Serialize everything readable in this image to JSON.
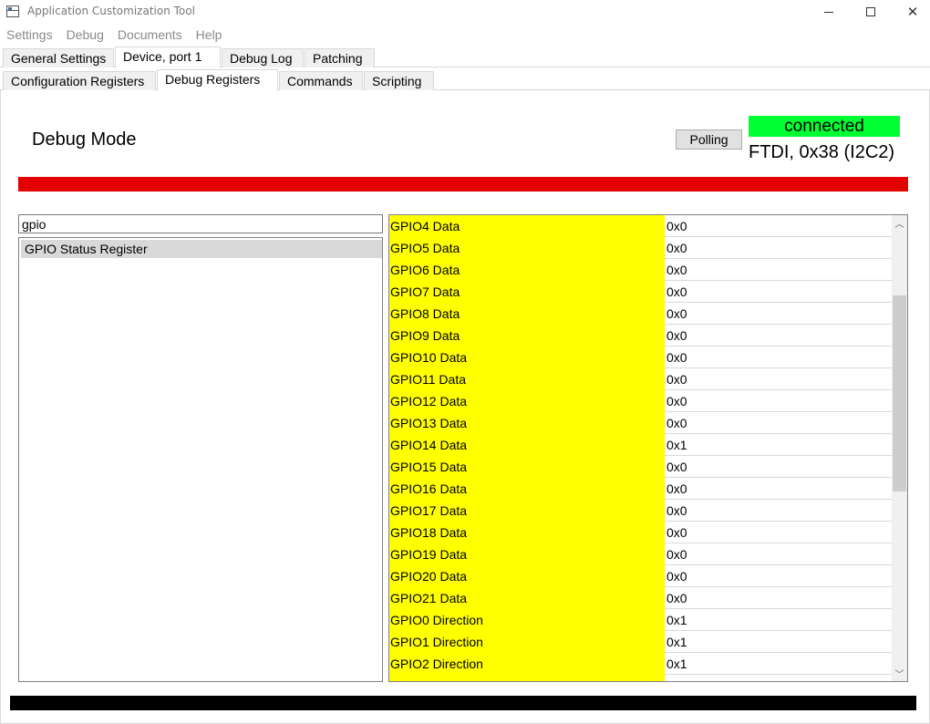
{
  "window": {
    "title": "Application Customization Tool"
  },
  "menu": {
    "items": [
      "Settings",
      "Debug",
      "Documents",
      "Help"
    ]
  },
  "tabs": {
    "top": [
      "General Settings",
      "Device, port 1",
      "Debug Log",
      "Patching"
    ],
    "top_active": "Device, port 1",
    "sub": [
      "Configuration Registers",
      "Debug Registers",
      "Commands",
      "Scripting"
    ],
    "sub_active": "Debug Registers"
  },
  "header": {
    "mode_title": "Debug Mode",
    "polling_label": "Polling",
    "status_text": "connected",
    "connection_info": "FTDI, 0x38 (I2C2)"
  },
  "colors": {
    "status_ok": "#00ff33",
    "alert_bar": "#e30000",
    "highlight": "#ffff00",
    "footer_bar": "#000000"
  },
  "search": {
    "value": "gpio"
  },
  "register_list": {
    "items": [
      "GPIO Status Register"
    ],
    "selected": "GPIO Status Register"
  },
  "grid": {
    "rows": [
      {
        "name": "GPIO4 Data",
        "value": "0x0"
      },
      {
        "name": "GPIO5 Data",
        "value": "0x0"
      },
      {
        "name": "GPIO6 Data",
        "value": "0x0"
      },
      {
        "name": "GPIO7 Data",
        "value": "0x0"
      },
      {
        "name": "GPIO8 Data",
        "value": "0x0"
      },
      {
        "name": "GPIO9 Data",
        "value": "0x0"
      },
      {
        "name": "GPIO10 Data",
        "value": "0x0"
      },
      {
        "name": "GPIO11 Data",
        "value": "0x0"
      },
      {
        "name": "GPIO12 Data",
        "value": "0x0"
      },
      {
        "name": "GPIO13 Data",
        "value": "0x0"
      },
      {
        "name": "GPIO14 Data",
        "value": "0x1"
      },
      {
        "name": "GPIO15 Data",
        "value": "0x0"
      },
      {
        "name": "GPIO16 Data",
        "value": "0x0"
      },
      {
        "name": "GPIO17 Data",
        "value": "0x0"
      },
      {
        "name": "GPIO18 Data",
        "value": "0x0"
      },
      {
        "name": "GPIO19 Data",
        "value": "0x0"
      },
      {
        "name": "GPIO20 Data",
        "value": "0x0"
      },
      {
        "name": "GPIO21 Data",
        "value": "0x0"
      },
      {
        "name": "GPIO0 Direction",
        "value": "0x1"
      },
      {
        "name": "GPIO1 Direction",
        "value": "0x1"
      },
      {
        "name": "GPIO2 Direction",
        "value": "0x1"
      },
      {
        "name": "",
        "value": ""
      }
    ]
  }
}
